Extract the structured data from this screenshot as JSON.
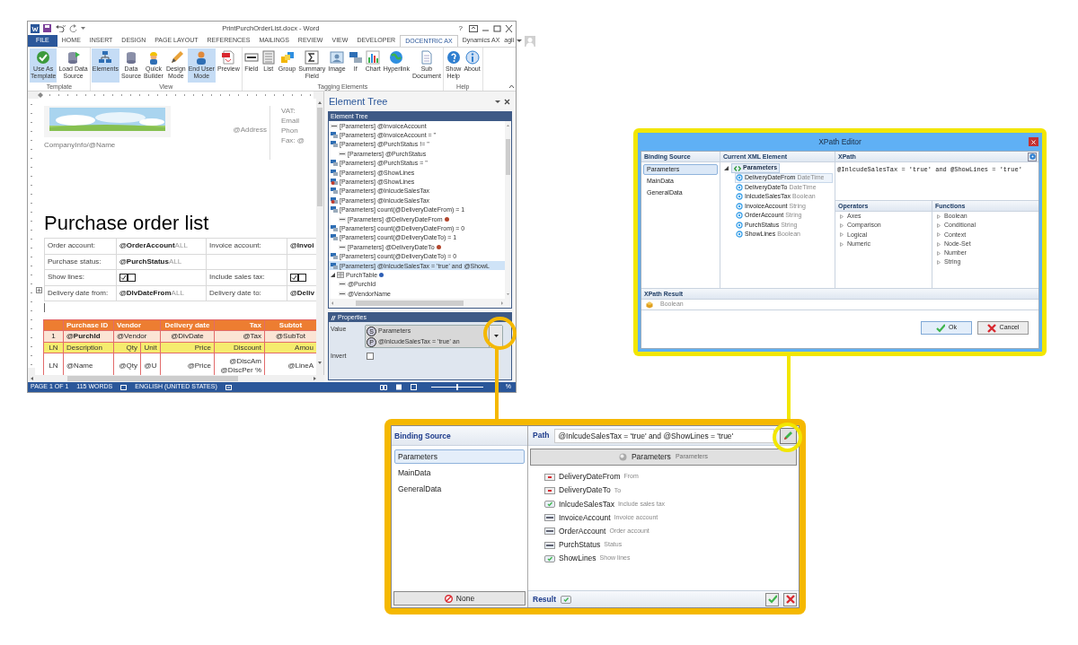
{
  "word": {
    "title": "PrintPurchOrderList.docx - Word",
    "help": "?",
    "user": "agli",
    "tabs": [
      {
        "label": "FILE",
        "kind": "file",
        "selected": false
      },
      {
        "label": "HOME",
        "kind": "tab",
        "selected": false
      },
      {
        "label": "INSERT",
        "kind": "tab",
        "selected": false
      },
      {
        "label": "DESIGN",
        "kind": "tab",
        "selected": false
      },
      {
        "label": "PAGE LAYOUT",
        "kind": "tab",
        "selected": false
      },
      {
        "label": "REFERENCES",
        "kind": "tab",
        "selected": false
      },
      {
        "label": "MAILINGS",
        "kind": "tab",
        "selected": false
      },
      {
        "label": "REVIEW",
        "kind": "tab",
        "selected": false
      },
      {
        "label": "VIEW",
        "kind": "tab",
        "selected": false
      },
      {
        "label": "DEVELOPER",
        "kind": "tab",
        "selected": false
      },
      {
        "label": "DOCENTRIC AX",
        "kind": "tab",
        "selected": true
      },
      {
        "label": "Dynamics AX",
        "kind": "tab",
        "selected": false
      }
    ],
    "ribbon_groups": [
      {
        "label": "Template",
        "buttons": [
          {
            "label": "Use As\nTemplate",
            "selected": true
          },
          {
            "label": "Load Data\nSource",
            "selected": false
          }
        ]
      },
      {
        "label": "View",
        "buttons": [
          {
            "label": "Elements",
            "selected": true
          },
          {
            "label": "Data\nSource",
            "selected": false
          },
          {
            "label": "Quick\nBuilder",
            "selected": false
          },
          {
            "label": "Design\nMode",
            "selected": false
          },
          {
            "label": "End User\nMode",
            "selected": true
          },
          {
            "label": "Preview",
            "selected": false
          }
        ]
      },
      {
        "label": "Tagging Elements",
        "buttons": [
          {
            "label": "Field",
            "selected": false
          },
          {
            "label": "List",
            "selected": false
          },
          {
            "label": "Group",
            "selected": false
          },
          {
            "label": "Summary\nField",
            "selected": false
          },
          {
            "label": "Image",
            "selected": false
          },
          {
            "label": "If",
            "selected": false
          },
          {
            "label": "Chart",
            "selected": false
          },
          {
            "label": "Hyperlink",
            "selected": false
          },
          {
            "label": "Sub\nDocument",
            "selected": false
          }
        ]
      },
      {
        "label": "Help",
        "buttons": [
          {
            "label": "Show\nHelp",
            "selected": false
          },
          {
            "label": "About",
            "selected": false
          }
        ]
      }
    ],
    "document": {
      "company_name": "CompanyInfo/@Name",
      "address": "@Address",
      "contact_labels": [
        "VAT:",
        "Email",
        "Phon",
        "Fax: @"
      ],
      "heading": "Purchase order list",
      "parameters_table": [
        [
          {
            "text": "Order account:"
          },
          {
            "field": "@OrderAccount",
            "suffix": "ALL"
          },
          {
            "text": "Invoice account:"
          },
          {
            "field": "@Invoi"
          }
        ],
        [
          {
            "text": "Purchase status:"
          },
          {
            "field": "@PurchStatus",
            "suffix": "ALL"
          }
        ],
        [
          {
            "text": "Show lines:"
          },
          {
            "checkboxes": [
              {
                "checked": true
              },
              {
                "checked": false
              }
            ]
          },
          {
            "text": "Include sales tax:"
          },
          {
            "checkboxes": [
              {
                "checked": true
              },
              {
                "checked": false
              }
            ]
          }
        ],
        [
          {
            "text": "Delivery date from:"
          },
          {
            "field": "@DlvDateFrom",
            "suffix": "ALL"
          },
          {
            "text": "Delivery date to:"
          },
          {
            "field": "@Deliv"
          }
        ]
      ],
      "order_table": [
        {
          "kind": "header",
          "cells": [
            {},
            {
              "text": "Purchase ID"
            },
            {
              "text": "Vendor"
            },
            {
              "text": "Delivery date"
            },
            {
              "text": "Tax"
            },
            {
              "text": "Subtot"
            }
          ]
        },
        {
          "kind": "order",
          "cells": [
            {
              "text": "1"
            },
            {
              "text": "@PurchId",
              "bold": true
            },
            {
              "text": "@Vendor"
            },
            {
              "text": "@DlvDate"
            },
            {
              "text": "@Tax"
            },
            {
              "text": "@SubTot"
            }
          ]
        },
        {
          "kind": "line_header",
          "cells": [
            {
              "text": "LN"
            },
            {
              "text": "Description"
            },
            {
              "text": "Qty"
            },
            {
              "text": "Unit"
            },
            {
              "text": "Price"
            },
            {
              "text": "Discount"
            },
            {
              "text": "Amou"
            }
          ]
        },
        {
          "kind": "line",
          "cells": [
            {
              "text": "LN"
            },
            {
              "text": "@Name"
            },
            {
              "text": "@Qty"
            },
            {
              "text": "@U"
            },
            {
              "text": "@Price"
            },
            {
              "text": "@DiscAm\n@DiscPer %"
            },
            {
              "text": "@LineA"
            }
          ]
        }
      ]
    },
    "element_tree": {
      "title": "Element Tree",
      "panel_title": "Element Tree",
      "items": [
        {
          "kind": "field",
          "label": "[Parameters] @InvoiceAccount",
          "selected": false
        },
        {
          "kind": "if",
          "label": "[Parameters] @InvoiceAccount = ''",
          "selected": false
        },
        {
          "kind": "if",
          "label": "[Parameters] @PurchStatus != ''",
          "selected": false,
          "children": [
            {
              "kind": "field",
              "label": "[Parameters] @PurchStatus",
              "selected": false
            }
          ]
        },
        {
          "kind": "if",
          "label": "[Parameters] @PurchStatus = ''",
          "selected": false
        },
        {
          "kind": "if",
          "label": "[Parameters] @ShowLines",
          "selected": false
        },
        {
          "kind": "if_false",
          "label": "[Parameters] @ShowLines",
          "selected": false
        },
        {
          "kind": "if",
          "label": "[Parameters] @InlcudeSalesTax",
          "selected": false
        },
        {
          "kind": "if_false",
          "label": "[Parameters] @InlcudeSalesTax",
          "selected": false
        },
        {
          "kind": "if",
          "label": "[Parameters] count(@DeliveryDateFrom) = 1",
          "selected": false,
          "children": [
            {
              "kind": "field",
              "label": "[Parameters] @DeliveryDateFrom",
              "color": "#b3472e",
              "selected": false
            }
          ]
        },
        {
          "kind": "if",
          "label": "[Parameters] count(@DeliveryDateFrom) = 0",
          "selected": false
        },
        {
          "kind": "if",
          "label": "[Parameters] count(@DeliveryDateTo) = 1",
          "selected": false,
          "children": [
            {
              "kind": "field",
              "label": "[Parameters] @DeliveryDateTo",
              "color": "#b3472e",
              "selected": false
            }
          ]
        },
        {
          "kind": "if",
          "label": "[Parameters] count(@DeliveryDateTo) = 0",
          "selected": false
        },
        {
          "kind": "if",
          "label": "[Parameters] @InlcudeSalesTax = 'true' and @ShowL",
          "selected": true
        },
        {
          "kind": "group",
          "label": "PurchTable",
          "color": "#2f5fb5",
          "expanded": true,
          "selected": false,
          "children": [
            {
              "kind": "field",
              "label": "@PurchId",
              "selected": false
            },
            {
              "kind": "field",
              "label": "@VendorName",
              "selected": false
            }
          ]
        }
      ],
      "properties": {
        "title": "Properties",
        "value_label": "Value",
        "value_lines": [
          {
            "badge": "S",
            "text": "Parameters"
          },
          {
            "badge": "P",
            "text": "@InlcudeSalesTax = 'true' an"
          }
        ],
        "invert_label": "Invert",
        "invert_checked": false
      }
    },
    "status_bar": {
      "items": [
        "PAGE 1 OF 1",
        "115 WORDS",
        "ENGLISH (UNITED STATES)"
      ],
      "zoom": "%",
      "zoom_slider": {
        "level": 0.5
      }
    }
  },
  "xpath_editor": {
    "title": "XPath Editor",
    "binding_source": {
      "header": "Binding Source",
      "items": [
        {
          "label": "Parameters",
          "selected": true
        },
        {
          "label": "MainData",
          "selected": false
        },
        {
          "label": "GeneralData",
          "selected": false
        }
      ]
    },
    "current_xml_element": {
      "header": "Current XML Element",
      "root": "Parameters",
      "expanded": true,
      "children": [
        {
          "name": "DeliveryDateFrom",
          "type": "DateTime",
          "selected": true
        },
        {
          "name": "DeliveryDateTo",
          "type": "DateTime",
          "selected": false
        },
        {
          "name": "InlcudeSalesTax",
          "type": "Boolean",
          "selected": false
        },
        {
          "name": "InvoiceAccount",
          "type": "String",
          "selected": false
        },
        {
          "name": "OrderAccount",
          "type": "String",
          "selected": false
        },
        {
          "name": "PurchStatus",
          "type": "String",
          "selected": false
        },
        {
          "name": "ShowLines",
          "type": "Boolean",
          "selected": false
        }
      ]
    },
    "xpath": {
      "header": "XPath",
      "value": "@InlcudeSalesTax = 'true' and @ShowLines = 'true'"
    },
    "operators": {
      "header": "Operators",
      "items": [
        "Axes",
        "Comparison",
        "Logical",
        "Numeric"
      ]
    },
    "functions": {
      "header": "Functions",
      "items": [
        "Boolean",
        "Conditional",
        "Context",
        "Node-Set",
        "Number",
        "String"
      ]
    },
    "result": {
      "header": "XPath Result",
      "type": "Boolean"
    },
    "buttons": [
      {
        "label": "Ok",
        "kind": "ok"
      },
      {
        "label": "Cancel",
        "kind": "cancel"
      }
    ]
  },
  "binding_editor": {
    "binding_source": {
      "header": "Binding Source",
      "items": [
        {
          "label": "Parameters",
          "selected": true
        },
        {
          "label": "MainData",
          "selected": false
        },
        {
          "label": "GeneralData",
          "selected": false
        }
      ]
    },
    "none_button": "None",
    "path": {
      "label": "Path",
      "value": "@InlcudeSalesTax = 'true' and @ShowLines = 'true'"
    },
    "root": {
      "label": "Parameters",
      "caption": "Parameters"
    },
    "fields": [
      {
        "kind": "date",
        "name": "DeliveryDateFrom",
        "caption": "From"
      },
      {
        "kind": "date",
        "name": "DeliveryDateTo",
        "caption": "To"
      },
      {
        "kind": "bool",
        "name": "InlcudeSalesTax",
        "caption": "Include sales tax"
      },
      {
        "kind": "text",
        "name": "InvoiceAccount",
        "caption": "Invoice account"
      },
      {
        "kind": "text",
        "name": "OrderAccount",
        "caption": "Order account"
      },
      {
        "kind": "text",
        "name": "PurchStatus",
        "caption": "Status"
      },
      {
        "kind": "bool",
        "name": "ShowLines",
        "caption": "Show lines"
      }
    ],
    "result_label": "Result"
  }
}
